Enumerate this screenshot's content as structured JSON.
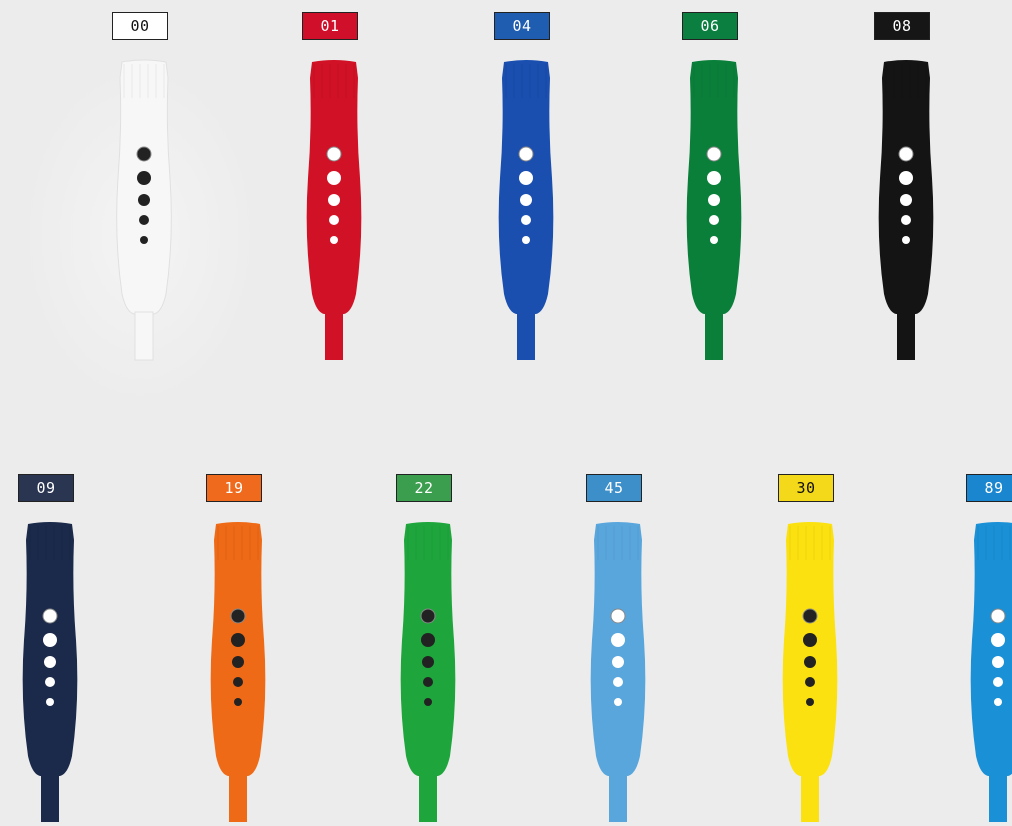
{
  "colors": [
    {
      "code": "00",
      "fill": "#f7f7f7",
      "dots": "#222222",
      "tag_bg": "#ffffff",
      "tag_text": "dark"
    },
    {
      "code": "01",
      "fill": "#d11226",
      "dots": "#ffffff",
      "tag_bg": "#d0102a",
      "tag_text": "light"
    },
    {
      "code": "04",
      "fill": "#1a4fb0",
      "dots": "#ffffff",
      "tag_bg": "#1e5db0",
      "tag_text": "light"
    },
    {
      "code": "06",
      "fill": "#0a7f3a",
      "dots": "#ffffff",
      "tag_bg": "#0b7f3f",
      "tag_text": "light"
    },
    {
      "code": "08",
      "fill": "#141414",
      "dots": "#ffffff",
      "tag_bg": "#161616",
      "tag_text": "light"
    },
    {
      "code": "09",
      "fill": "#1b2a4a",
      "dots": "#ffffff",
      "tag_bg": "#2a3552",
      "tag_text": "light"
    },
    {
      "code": "19",
      "fill": "#ee6a17",
      "dots": "#222222",
      "tag_bg": "#ef6a1c",
      "tag_text": "light"
    },
    {
      "code": "22",
      "fill": "#1ea63c",
      "dots": "#222222",
      "tag_bg": "#3b9e4e",
      "tag_text": "light"
    },
    {
      "code": "45",
      "fill": "#59a6dd",
      "dots": "#ffffff",
      "tag_bg": "#3d8fc9",
      "tag_text": "light"
    },
    {
      "code": "30",
      "fill": "#fbe10f",
      "dots": "#222222",
      "tag_bg": "#f3d91a",
      "tag_text": "dark"
    },
    {
      "code": "89",
      "fill": "#1a90d6",
      "dots": "#ffffff",
      "tag_bg": "#1a86cf",
      "tag_text": "light"
    }
  ]
}
